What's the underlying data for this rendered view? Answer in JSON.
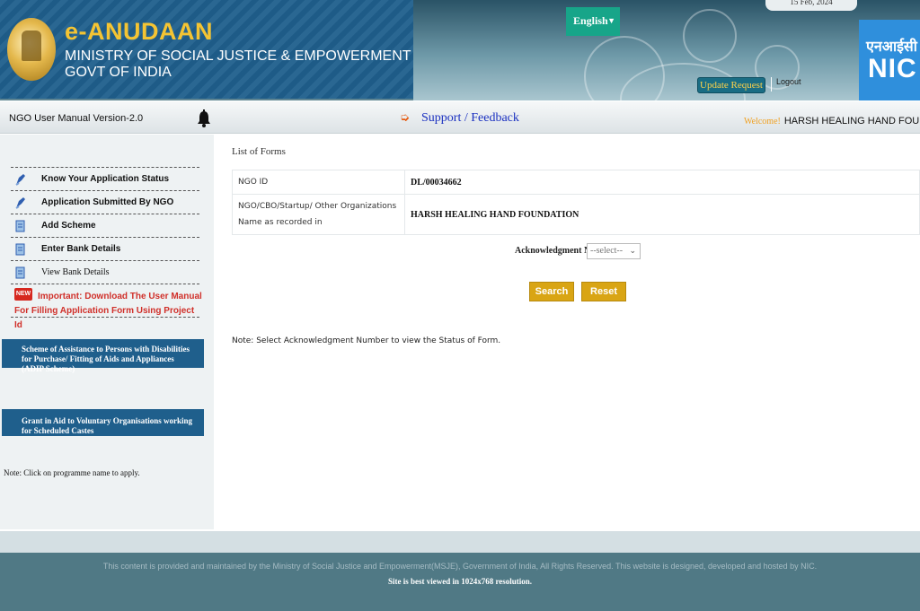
{
  "header": {
    "site_title": "e-ANUDAAN",
    "ministry": "MINISTRY OF SOCIAL JUSTICE & EMPOWERMENT",
    "govt": "GOVT OF INDIA",
    "date": "15 Feb, 2024",
    "language": "English",
    "update_request": "Update Request",
    "logout": "Logout",
    "nic_hindi": "एनआईसी",
    "nic": "NIC"
  },
  "topbar": {
    "manual_version": "NGO User Manual Version-2.0",
    "support": "Support / Feedback",
    "welcome_label": "Welcome!",
    "welcome_name": "HARSH HEALING HAND FOUNDATION"
  },
  "sidebar": {
    "items": [
      {
        "label": "Know Your Application Status",
        "icon": "pen-icon"
      },
      {
        "label": "Application Submitted By NGO",
        "icon": "pen-icon"
      },
      {
        "label": "Add Scheme",
        "icon": "document-icon"
      },
      {
        "label": "Enter Bank Details",
        "icon": "document-icon"
      },
      {
        "label": "View Bank Details",
        "icon": "document-icon"
      }
    ],
    "new_badge": "NEW",
    "important": "Important: Download The User Manual For Filling Application Form Using Project Id",
    "schemes": [
      "Scheme of Assistance to Persons with Disabilities for Purchase/ Fitting of Aids and Appliances (ADIP Scheme)",
      "Grant in Aid to Voluntary Organisations working for Scheduled Castes"
    ],
    "note": "Note: Click on programme name to apply."
  },
  "main": {
    "heading": "List of Forms",
    "ngo_id_label": "NGO ID",
    "ngo_id_value": "DL/00034662",
    "org_name_label": "NGO/CBO/Startup/ Other Organizations Name as recorded in",
    "org_name_value": "HARSH HEALING HAND FOUNDATION",
    "ack_label": "Acknowledgment No.:",
    "ack_required": "*",
    "ack_selected": "--select--",
    "search": "Search",
    "reset": "Reset",
    "note": "Note: Select Acknowledgment Number to view the Status of Form."
  },
  "footer": {
    "line1": "This content is provided and maintained by the Ministry of Social Justice and Empowerment(MSJE), Government of India, All Rights Reserved. This website is designed, developed and hosted by NIC.",
    "line2": "Site is best viewed in 1024x768 resolution."
  },
  "colors": {
    "header_blue": "#1f5f8c",
    "title_gold": "#f4c433",
    "button_gold": "#d9a514",
    "language_green": "#17a589",
    "important_red": "#d0302a",
    "footer_teal": "#507985"
  }
}
